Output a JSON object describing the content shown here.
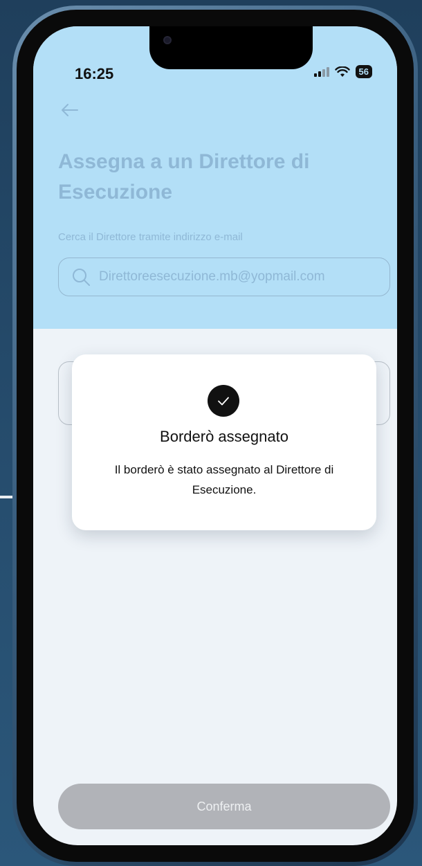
{
  "status_bar": {
    "time": "16:25",
    "battery": "56"
  },
  "page": {
    "title": "Assegna a un Direttore di Esecuzione",
    "subtitle": "Cerca il Direttore tramite indirizzo e-mail",
    "search": {
      "value": "Direttoreesecuzione.mb@yopmail.com"
    }
  },
  "modal": {
    "icon": "check-icon",
    "title": "Borderò assegnato",
    "message": "Il borderò è stato assegnato al Direttore di Esecuzione."
  },
  "footer": {
    "confirm_label": "Conferma"
  },
  "colors": {
    "header_bg": "#b3dff7",
    "screen_bg": "#eef3f8",
    "faded_text": "#8fb8d6",
    "button_disabled": "#b1b3b8"
  }
}
